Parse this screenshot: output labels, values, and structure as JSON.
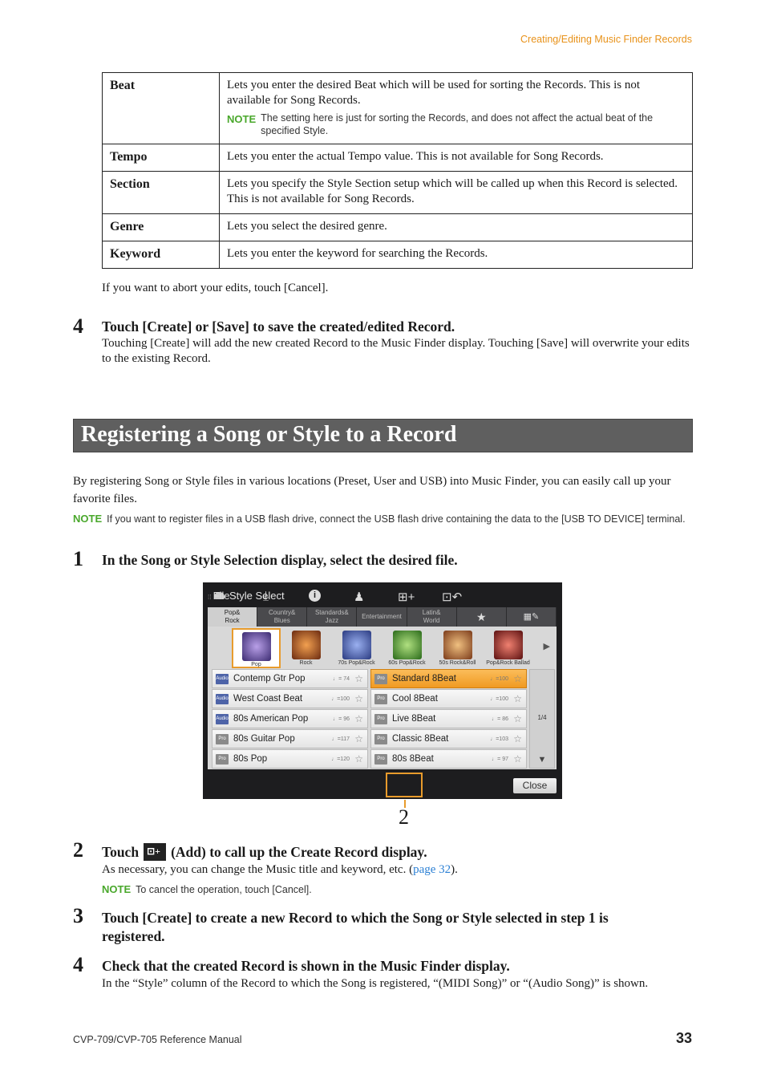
{
  "running_head": "Creating/Editing Music Finder Records",
  "table": {
    "rows": [
      {
        "term": "Beat",
        "desc": "Lets you enter the desired Beat which will be used for sorting the Records. This is not available for Song Records.",
        "note_label": "NOTE",
        "note": "The setting here is just for sorting the Records, and does not affect the actual beat of the specified Style."
      },
      {
        "term": "Tempo",
        "desc": "Lets you enter the actual Tempo value. This is not available for Song Records."
      },
      {
        "term": "Section",
        "desc": "Lets you specify the Style Section setup which will be called up when this Record is selected. This is not available for Song Records."
      },
      {
        "term": "Genre",
        "desc": "Lets you select the desired genre."
      },
      {
        "term": "Keyword",
        "desc": "Lets you enter the keyword for searching the Records."
      }
    ]
  },
  "abort_text": "If you want to abort your edits, touch [Cancel].",
  "step4a": {
    "num": "4",
    "title": "Touch [Create] or [Save] to save the created/edited Record.",
    "body": "Touching [Create] will add the new created Record to the Music Finder display. Touching [Save] will overwrite your edits to the existing Record."
  },
  "section_title": "Registering a Song or Style to a Record",
  "intro": "By registering Song or Style files in various locations (Preset, User and USB) into Music Finder, you can easily call up your favorite files.",
  "intro_note": {
    "label": "NOTE",
    "text": "If you want to register files in a USB flash drive, connect the USB flash drive containing the data to the [USB TO DEVICE] terminal."
  },
  "step1": {
    "num": "1",
    "title": "In the Song or Style Selection display, select the desired file."
  },
  "screen": {
    "title": "Style Select",
    "tabs": [
      {
        "label": "Pop&\nRock",
        "active": true
      },
      {
        "label": "Country&\nBlues"
      },
      {
        "label": "Standards&\nJazz"
      },
      {
        "label": "Entertainment"
      },
      {
        "label": "Latin&\nWorld"
      },
      {
        "label": "★",
        "icon": "star-icon"
      },
      {
        "label": "🎹✎",
        "icon": "piano-edit-icon"
      }
    ],
    "thumbs": [
      {
        "label": "Pop",
        "selected": true,
        "color": "#6a4fa0"
      },
      {
        "label": "Rock",
        "color": "#b4541e"
      },
      {
        "label": "70s Pop&Rock",
        "color": "#5a6fb8"
      },
      {
        "label": "60s Pop&Rock",
        "color": "#4f9a3a"
      },
      {
        "label": "50s Rock&Roll",
        "color": "#c87a3a"
      },
      {
        "label": "Pop&Rock Ballad",
        "color": "#a8302a"
      }
    ],
    "left_list": [
      {
        "badge": "Audio",
        "name": "Contemp Gtr Pop",
        "tempo": "♩= 74"
      },
      {
        "badge": "Audio",
        "name": "West Coast Beat",
        "tempo": "♩=100"
      },
      {
        "badge": "Audio",
        "name": "80s American Pop",
        "tempo": "♩= 96"
      },
      {
        "badge": "Pro",
        "name": "80s Guitar Pop",
        "tempo": "♩=117"
      },
      {
        "badge": "Pro",
        "name": "80s Pop",
        "tempo": "♩=120"
      }
    ],
    "right_list": [
      {
        "badge": "Pro",
        "name": "Standard 8Beat",
        "tempo": "♩=100",
        "selected": true
      },
      {
        "badge": "Pro",
        "name": "Cool 8Beat",
        "tempo": "♩=100"
      },
      {
        "badge": "Pro",
        "name": "Live 8Beat",
        "tempo": "♩= 86"
      },
      {
        "badge": "Pro",
        "name": "Classic 8Beat",
        "tempo": "♩=103"
      },
      {
        "badge": "Pro",
        "name": "80s 8Beat",
        "tempo": "♩= 97"
      }
    ],
    "page": "1/4",
    "toolbar": {
      "file": "File",
      "close": "Close"
    },
    "callout": "2"
  },
  "step2": {
    "num": "2",
    "title_pre": "Touch",
    "title_post": "(Add) to call up the Create Record display.",
    "body_pre": "As necessary, you can change the Music title and keyword, etc. (",
    "link": "page 32",
    "body_post": ").",
    "note_label": "NOTE",
    "note": "To cancel the operation, touch [Cancel]."
  },
  "step3": {
    "num": "3",
    "title": "Touch [Create] to create a new Record to which the Song or Style selected in step 1 is registered."
  },
  "step4b": {
    "num": "4",
    "title": "Check that the created Record is shown in the Music Finder display.",
    "body": "In the “Style” column of the Record to which the Song is registered, “(MIDI Song)” or “(Audio Song)” is shown."
  },
  "footer": {
    "manual": "CVP-709/CVP-705 Reference Manual",
    "page": "33"
  }
}
